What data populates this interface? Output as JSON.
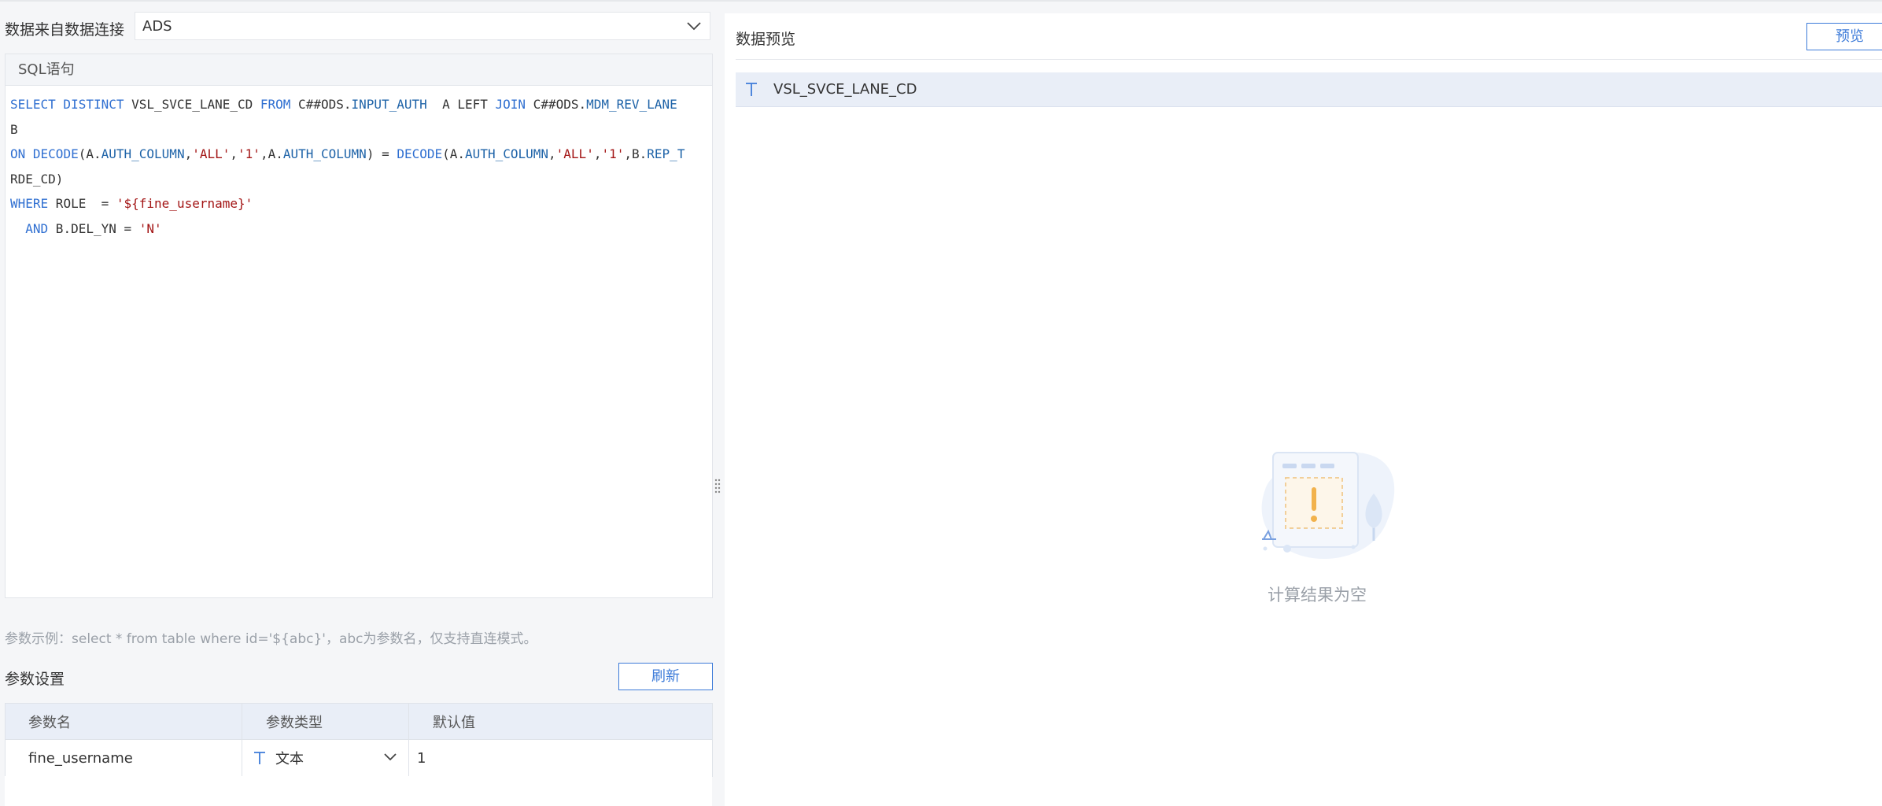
{
  "source": {
    "label": "数据来自数据连接",
    "selected": "ADS"
  },
  "sql": {
    "header": "SQL语句",
    "lines": [
      [
        {
          "t": "SELECT DISTINCT",
          "c": "kw"
        },
        {
          "t": " VSL_SVCE_LANE_CD ",
          "c": ""
        },
        {
          "t": "FROM",
          "c": "kw"
        },
        {
          "t": " C##ODS.",
          "c": ""
        },
        {
          "t": "INPUT_AUTH",
          "c": "fn"
        },
        {
          "t": "  A LEFT ",
          "c": ""
        },
        {
          "t": "JOIN",
          "c": "kw"
        },
        {
          "t": " C##ODS.",
          "c": ""
        },
        {
          "t": "MDM_REV_LANE",
          "c": "fn"
        }
      ],
      [
        {
          "t": "B",
          "c": ""
        }
      ],
      [
        {
          "t": "ON",
          "c": "kw"
        },
        {
          "t": " ",
          "c": ""
        },
        {
          "t": "DECODE",
          "c": "kw"
        },
        {
          "t": "(A.",
          "c": ""
        },
        {
          "t": "AUTH_COLUMN",
          "c": "fn"
        },
        {
          "t": ",",
          "c": ""
        },
        {
          "t": "'ALL'",
          "c": "str"
        },
        {
          "t": ",",
          "c": ""
        },
        {
          "t": "'1'",
          "c": "str"
        },
        {
          "t": ",A.",
          "c": ""
        },
        {
          "t": "AUTH_COLUMN",
          "c": "fn"
        },
        {
          "t": ") = ",
          "c": ""
        },
        {
          "t": "DECODE",
          "c": "kw"
        },
        {
          "t": "(A.",
          "c": ""
        },
        {
          "t": "AUTH_COLUMN",
          "c": "fn"
        },
        {
          "t": ",",
          "c": ""
        },
        {
          "t": "'ALL'",
          "c": "str"
        },
        {
          "t": ",",
          "c": ""
        },
        {
          "t": "'1'",
          "c": "str"
        },
        {
          "t": ",B.",
          "c": ""
        },
        {
          "t": "REP_T",
          "c": "fn"
        }
      ],
      [
        {
          "t": "RDE_CD)",
          "c": ""
        }
      ],
      [
        {
          "t": "WHERE",
          "c": "kw"
        },
        {
          "t": " ROLE  = ",
          "c": ""
        },
        {
          "t": "'${fine_username}'",
          "c": "str"
        }
      ],
      [
        {
          "t": "  ",
          "c": ""
        },
        {
          "t": "AND",
          "c": "kw"
        },
        {
          "t": " B.DEL_YN = ",
          "c": ""
        },
        {
          "t": "'N'",
          "c": "str"
        }
      ]
    ]
  },
  "hint": "参数示例：select * from table where id='${abc}'，abc为参数名，仅支持直连模式。",
  "params": {
    "title": "参数设置",
    "refresh_label": "刷新",
    "columns": [
      "参数名",
      "参数类型",
      "默认值"
    ],
    "rows": [
      {
        "name": "fine_username",
        "type": "文本",
        "default": "1"
      }
    ]
  },
  "preview": {
    "title": "数据预览",
    "button_label": "预览",
    "columns": [
      "VSL_SVCE_LANE_CD"
    ],
    "empty_text": "计算结果为空"
  },
  "icons": {
    "chevron": "chevron-down-icon",
    "text_type": "text-type-icon",
    "empty": "empty-result-illustration"
  },
  "colors": {
    "accent": "#3d7bd9",
    "keyword": "#2f6fd1",
    "string": "#a31515",
    "header_bg": "#e9eef7"
  }
}
